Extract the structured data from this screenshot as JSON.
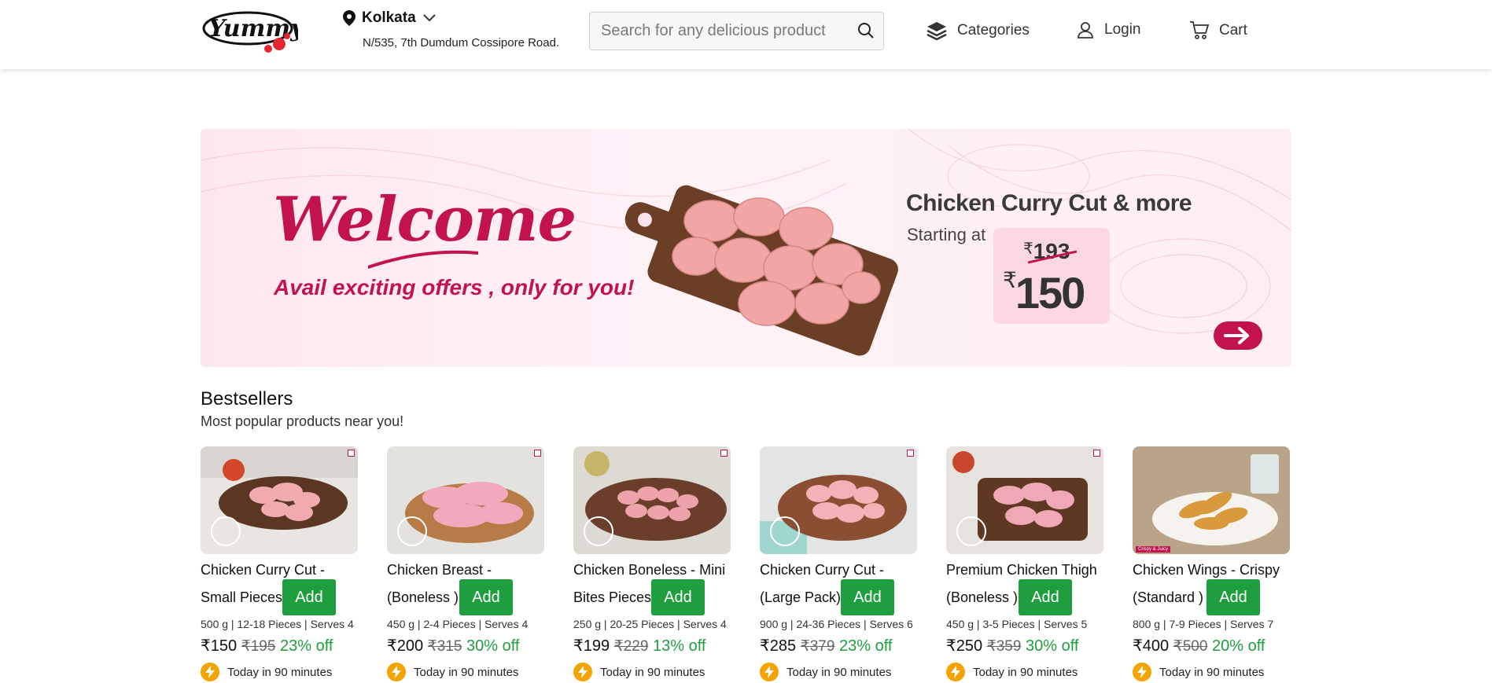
{
  "header": {
    "logo_text": "Yummy!",
    "location": {
      "city": "Kolkata",
      "address": "N/535, 7th Dumdum Cossipore Road."
    },
    "search": {
      "placeholder": "Search for any delicious product"
    },
    "nav": {
      "categories": "Categories",
      "login": "Login",
      "cart": "Cart"
    }
  },
  "banner": {
    "welcome": "Welcome",
    "tagline": "Avail exciting offers , only for you!",
    "offer_title": "Chicken Curry Cut & more",
    "starting_at": "Starting at",
    "currency": "₹",
    "old_price": "193",
    "new_price": "150"
  },
  "bestsellers": {
    "title": "Bestsellers",
    "subtitle": "Most popular products near you!",
    "add_label": "Add",
    "delivery_text": "Today in 90 minutes",
    "products": [
      {
        "name": "Chicken Curry Cut - Small Pieces",
        "meta": "500 g | 12-18 Pieces | Serves 4",
        "price": "₹150",
        "mrp": "₹195",
        "off": "23% off",
        "tag": ""
      },
      {
        "name": "Chicken Breast - (Boneless )",
        "meta": "450 g | 2-4 Pieces | Serves 4",
        "price": "₹200",
        "mrp": "₹315",
        "off": "30% off",
        "tag": ""
      },
      {
        "name": "Chicken Boneless - Mini Bites Pieces",
        "meta": "250 g | 20-25 Pieces | Serves 4",
        "price": "₹199",
        "mrp": "₹229",
        "off": "13% off",
        "tag": ""
      },
      {
        "name": "Chicken Curry Cut - (Large Pack)",
        "meta": "900 g | 24-36 Pieces | Serves 6",
        "price": "₹285",
        "mrp": "₹379",
        "off": "23% off",
        "tag": ""
      },
      {
        "name": "Premium Chicken Thigh (Boneless )",
        "meta": "450 g | 3-5 Pieces | Serves 5",
        "price": "₹250",
        "mrp": "₹359",
        "off": "30% off",
        "tag": ""
      },
      {
        "name": "Chicken Wings - Crispy (Standard )",
        "meta": "800 g | 7-9 Pieces | Serves 7",
        "price": "₹400",
        "mrp": "₹500",
        "off": "20% off",
        "tag": "Crispy & Juicy"
      }
    ]
  },
  "colors": {
    "brand": "#c2134f",
    "green": "#1e9e3e",
    "bolt": "#f4a300"
  },
  "icons": [
    "location-pin-icon",
    "chevron-down-icon",
    "search-icon",
    "layers-icon",
    "user-icon",
    "cart-icon",
    "arrow-right-icon",
    "bolt-icon"
  ]
}
